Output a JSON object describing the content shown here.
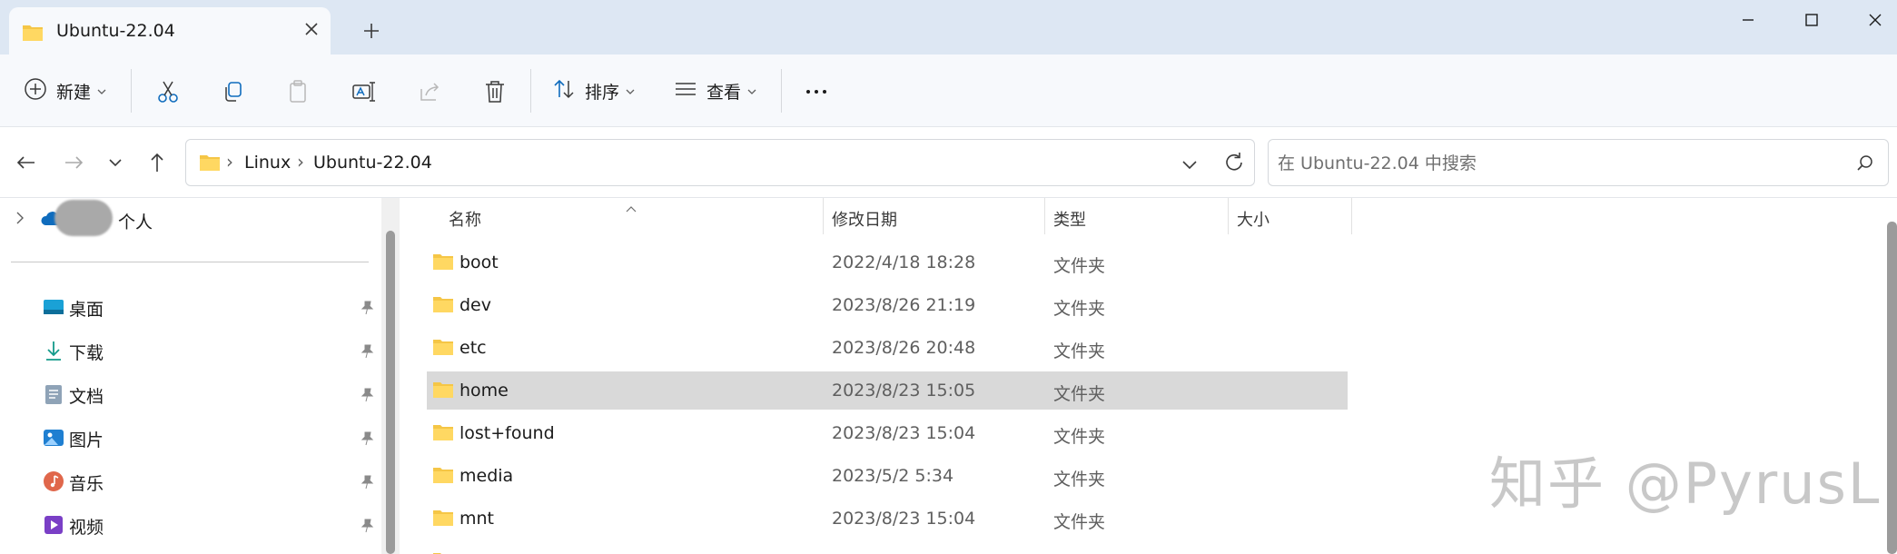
{
  "window": {
    "tab_title": "Ubuntu-22.04"
  },
  "toolbar": {
    "new_label": "新建",
    "sort_label": "排序",
    "view_label": "查看"
  },
  "address": {
    "crumbs": [
      "Linux",
      "Ubuntu-22.04"
    ]
  },
  "search": {
    "placeholder": "在 Ubuntu-22.04 中搜索"
  },
  "sidebar": {
    "personal_label": "个人",
    "items": [
      {
        "label": "桌面",
        "icon": "desktop-icon"
      },
      {
        "label": "下载",
        "icon": "download-icon"
      },
      {
        "label": "文档",
        "icon": "documents-icon"
      },
      {
        "label": "图片",
        "icon": "pictures-icon"
      },
      {
        "label": "音乐",
        "icon": "music-icon"
      },
      {
        "label": "视频",
        "icon": "videos-icon"
      }
    ]
  },
  "file_list": {
    "columns": [
      "名称",
      "修改日期",
      "类型",
      "大小"
    ],
    "rows": [
      {
        "name": "boot",
        "date": "2022/4/18 18:28",
        "type": "文件夹"
      },
      {
        "name": "dev",
        "date": "2023/8/26 21:19",
        "type": "文件夹"
      },
      {
        "name": "etc",
        "date": "2023/8/26 20:48",
        "type": "文件夹"
      },
      {
        "name": "home",
        "date": "2023/8/23 15:05",
        "type": "文件夹",
        "selected": true
      },
      {
        "name": "lost+found",
        "date": "2023/8/23 15:04",
        "type": "文件夹"
      },
      {
        "name": "media",
        "date": "2023/5/2 5:34",
        "type": "文件夹"
      },
      {
        "name": "mnt",
        "date": "2023/8/23 15:04",
        "type": "文件夹"
      }
    ]
  },
  "watermark": "知乎 @PyrusL",
  "colors": {
    "titlebar": "#dde7f3",
    "toolbar": "#f7f9fc",
    "selection": "#d9d9d9",
    "folder": "#f5c646"
  }
}
